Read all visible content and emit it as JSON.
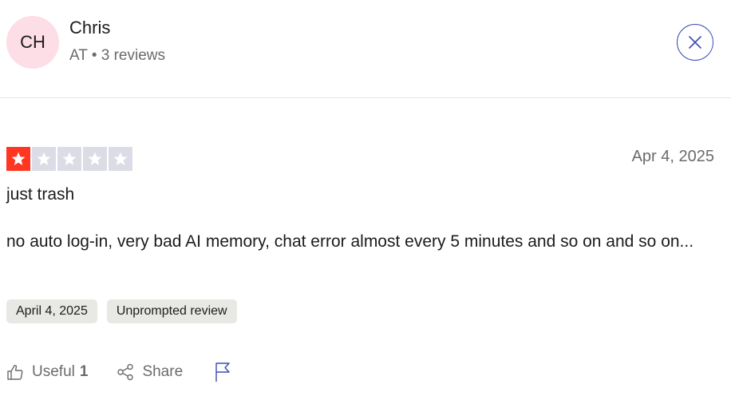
{
  "reviewer": {
    "initials": "CH",
    "name": "Chris",
    "country": "AT",
    "separator": "•",
    "reviews_count": "3 reviews"
  },
  "review": {
    "rating": 1,
    "max_rating": 5,
    "date": "Apr 4, 2025",
    "title": "just trash",
    "body": "no auto log-in, very bad AI memory, chat error almost every 5 minutes and so on and so on...",
    "tags": [
      "April 4, 2025",
      "Unprompted review"
    ]
  },
  "actions": {
    "useful_label": "Useful",
    "useful_count": "1",
    "share_label": "Share"
  },
  "icons": {
    "close": "close-icon",
    "thumbs_up": "thumbs-up-icon",
    "share": "share-icon",
    "flag": "flag-icon",
    "star": "star-icon"
  },
  "colors": {
    "star_on": "#ff3722",
    "star_off": "#dcdce6",
    "avatar_bg": "#fddde6",
    "close_border": "#3b4bb8",
    "tag_bg": "#e8e8e4"
  }
}
